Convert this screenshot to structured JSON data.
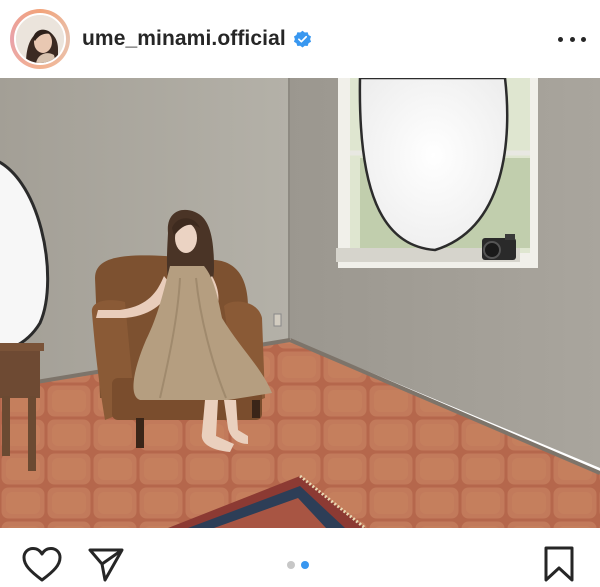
{
  "post": {
    "username": "ume_minami.official",
    "verified": true,
    "carousel": {
      "total": 2,
      "active": 2
    }
  },
  "icons": {
    "more": "more-options-icon",
    "like": "heart-icon",
    "share": "paper-plane-icon",
    "save": "bookmark-icon",
    "verified": "verified-badge-icon"
  },
  "colors": {
    "verified": "#3897f0",
    "text": "#262626",
    "dot_active": "#3897f0",
    "dot_inactive": "#c7c7c7"
  }
}
